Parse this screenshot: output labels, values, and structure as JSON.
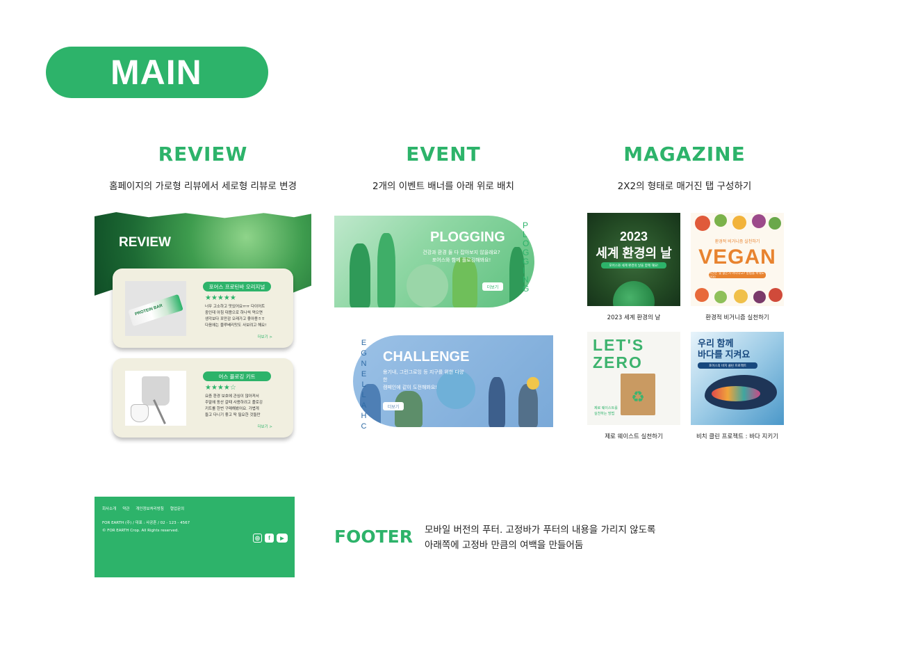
{
  "main": {
    "title": "MAIN"
  },
  "review": {
    "title": "REVIEW",
    "desc": "홈페이지의 가로형 리뷰에서 세로형 리뷰로 변경",
    "banner_title": "REVIEW",
    "cards": [
      {
        "tag": "포어스 프로틴바 오리지널",
        "stars": "★★★★★",
        "text": "너무 고소하고 맛있어요ㅠㅠ 다이어트\n중인데 아침 대용으로 하나씩 먹으면\n생각보다 포만감 오래가고 좋아용ㅎㅎ\n다음에는 블루베리맛도 사보려고 해요!",
        "more": "더보기 >",
        "product_label": "PROTEIN BAR"
      },
      {
        "tag": "어스 플로깅 키트",
        "stars": "★★★★☆",
        "text": "요즘 환경 보호에 관심이 많아져서\n주말에 동산 갈때 사용하려고 플로깅\n키트를 한번 구매해봤어요. 가볍게\n들고 다니기 좋고 딱 필요한 것들만",
        "more": "더보기 >"
      }
    ]
  },
  "event": {
    "title": "EVENT",
    "desc": "2개의 이벤트 배너를 아래 위로 배치",
    "banners": [
      {
        "title": "PLOGGING",
        "sub": "건강과 환경 둘 다 잡아보지 않을래요?\n포어스와 함께 플로깅해봐요!",
        "button": "더보기",
        "arc": "PLOGGING"
      },
      {
        "title": "CHALLENGE",
        "sub": "용기내, 그린그로잉 등 지구를 위한 다양한\n캠페인에 같이 도전해봐요!",
        "button": "더보기",
        "arc": "CHALLENGE"
      }
    ]
  },
  "magazine": {
    "title": "MAGAZINE",
    "desc": "2X2의 형태로 매거진 탭 구성하기",
    "items": [
      {
        "title": "2023\n세계 환경의 날",
        "band": "포어스와 세계 환경의 날을 함께 해요!",
        "caption": "2023 세계 환경의 날"
      },
      {
        "small": "환경적 비거니즘 실천하기",
        "title": "VEGAN",
        "band": "비건은 몇 없는거 아니냐고? 방법을 바꿔도 있어!",
        "caption": "환경적 비거니즘 실천하기"
      },
      {
        "title": "LET'S\nZERO",
        "sub": "제로 웨이스트를\n실천하는 방법",
        "caption": "제로 웨이스트 실천하기"
      },
      {
        "title": "우리 함께\n바다를 지켜요",
        "band": "포어스의 비치 클린 프로젝트",
        "caption": "비치 클린 프로젝트 : 바다 지키기"
      }
    ]
  },
  "footer": {
    "title": "FOOTER",
    "desc": "모바일 버전의 푸터. 고정바가 푸터의 내용을 가리지 않도록\n아래쪽에 고정바 만큼의 여백을 만들어둠",
    "links": [
      "회사소개",
      "약관",
      "개인정보처리방침",
      "협업문의"
    ],
    "info": "FOR EARTH (주) / 대표 : 사공흔 / 02 - 123 - 4567\n© FOR EARTH Crop. All Rights reserved.",
    "icons": [
      "instagram-icon",
      "facebook-icon",
      "youtube-icon"
    ]
  },
  "colors": {
    "accent": "#2db36a",
    "card": "#f1efe0",
    "event_blue": "#7aa9d8"
  }
}
